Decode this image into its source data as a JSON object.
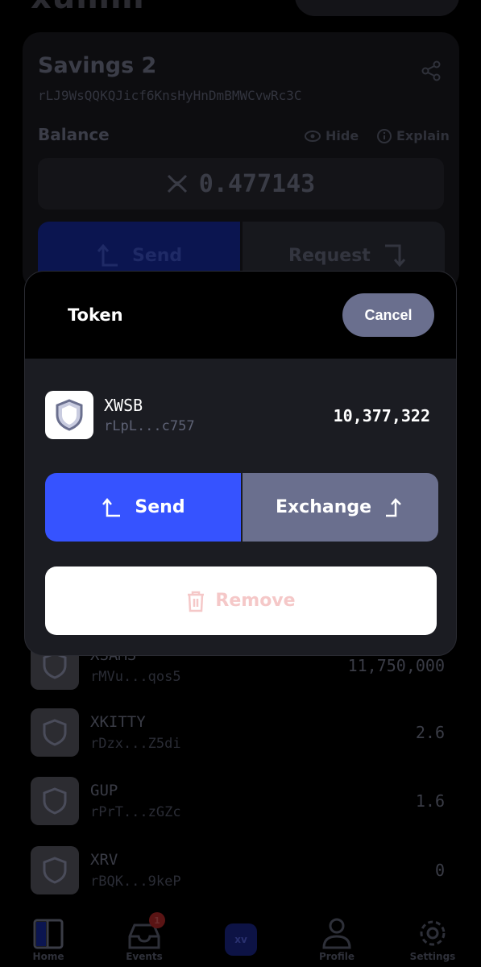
{
  "header": {
    "app_logo": "xumm"
  },
  "account": {
    "name": "Savings 2",
    "address": "rLJ9WsQQKQJicf6KnsHyHnDmBMWCvwRc3C",
    "balance_label": "Balance",
    "hide_label": "Hide",
    "explain_label": "Explain",
    "balance_value": "0.477143",
    "send_label": "Send",
    "request_label": "Request"
  },
  "tokens": [
    {
      "name": "XSAMS",
      "issuer": "rMVu...qos5",
      "amount": "11,750,000"
    },
    {
      "name": "XKITTY",
      "issuer": "rDzx...Z5di",
      "amount": "2.6"
    },
    {
      "name": "GUP",
      "issuer": "rPrT...zGZc",
      "amount": "1.6"
    },
    {
      "name": "XRV",
      "issuer": "rBQK...9keP",
      "amount": "0"
    }
  ],
  "modal": {
    "title": "Token",
    "cancel_label": "Cancel",
    "token": {
      "name": "XWSB",
      "issuer": "rLpL...c757",
      "amount": "10,377,322"
    },
    "send_label": "Send",
    "exchange_label": "Exchange",
    "remove_label": "Remove"
  },
  "tabbar": {
    "home": "Home",
    "events": "Events",
    "events_badge": "1",
    "center": "xv",
    "profile": "Profile",
    "settings": "Settings"
  },
  "colors": {
    "accent_blue": "#3653ff",
    "secondary_gray": "#6a6f8e",
    "remove_text": "#f5c8c8",
    "modal_bg": "#1b1c22"
  }
}
